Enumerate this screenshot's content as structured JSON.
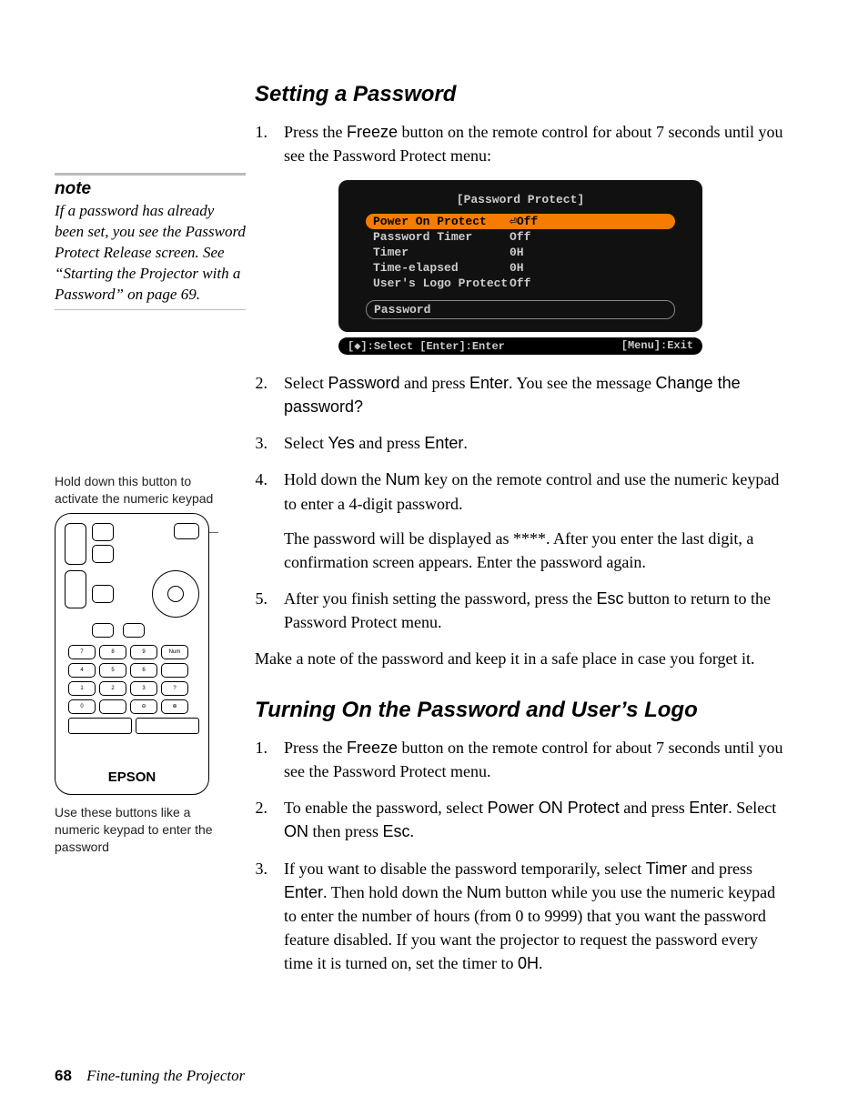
{
  "heading1": "Setting a Password",
  "s1": [
    {
      "n": "1.",
      "pre": "Press the ",
      "bold1": "Freeze",
      "post": " button on the remote control for about 7 seconds until you see the Password Protect menu:"
    },
    {
      "n": "2.",
      "pre": "Select ",
      "bold1": "Password",
      "mid1": " and press ",
      "bold2": "Enter",
      "mid2": ". You see the message ",
      "bold3": "Change the password?"
    },
    {
      "n": "3.",
      "pre": "Select ",
      "bold1": "Yes",
      "mid1": " and press ",
      "bold2": "Enter",
      "post": "."
    },
    {
      "n": "4.",
      "pre": "Hold down the ",
      "bold1": "Num",
      "post": " key on the remote control and use the numeric keypad to enter a 4-digit password.",
      "extra": "The password will be displayed as ****. After you enter the last digit, a confirmation screen appears. Enter the password again."
    },
    {
      "n": "5.",
      "pre": "After you finish setting the password, press the ",
      "bold1": "Esc",
      "post": " button to return to the Password Protect menu."
    }
  ],
  "closing": "Make a note of the password and keep it in a safe place in case you forget it.",
  "heading2": "Turning On the Password and User’s Logo",
  "s2": [
    {
      "n": "1.",
      "pre": "Press the ",
      "bold1": "Freeze",
      "post": " button on the remote control for about 7 seconds until you see the Password Protect menu."
    },
    {
      "n": "2.",
      "pre": "To enable the password, select ",
      "bold1": "Power ON Protect",
      "mid1": " and press ",
      "bold2": "Enter",
      "mid2": ". Select ",
      "bold3": "ON",
      "mid3": " then press ",
      "bold4": "Esc",
      "post": "."
    },
    {
      "n": "3.",
      "pre": "If you want to disable the password temporarily, select ",
      "bold1": "Timer",
      "mid1": " and press ",
      "bold2": "Enter",
      "mid2": ". Then hold down the ",
      "bold3": "Num",
      "mid3": " button while you use the numeric keypad to enter the number of hours (from 0 to 9999) that you want the password feature disabled. If you want the projector to request the password every time it is turned on, set the timer to ",
      "bold4": "0H",
      "post": "."
    }
  ],
  "note": {
    "title": "note",
    "body": "If a password has already been set, you see the Password Protect Release screen. See “Starting the Projector with a Password” on page 69."
  },
  "cap1": "Hold down this button to activate the numeric keypad",
  "cap2": "Use these buttons like a numeric keypad to enter the password",
  "brand": "EPSON",
  "osd": {
    "title": "[Password Protect]",
    "rows": [
      {
        "l": "Power On Protect",
        "r": "⏎Off",
        "hi": true
      },
      {
        "l": "Password Timer",
        "r": "Off"
      },
      {
        "l": "  Timer",
        "r": "   0H"
      },
      {
        "l": "  Time-elapsed",
        "r": "   0H"
      },
      {
        "l": "User's Logo Protect",
        "r": "Off"
      }
    ],
    "pwd": "Password",
    "footL": "[◆]:Select [Enter]:Enter",
    "footR": "[Menu]:Exit"
  },
  "footer": {
    "page": "68",
    "title": "Fine-tuning the Projector"
  }
}
